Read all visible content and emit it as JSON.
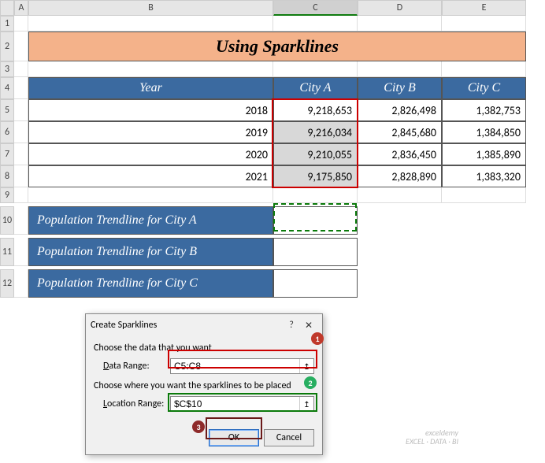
{
  "columns": [
    "A",
    "B",
    "C",
    "D",
    "E"
  ],
  "title": "Using Sparklines",
  "headers": {
    "year": "Year",
    "cityA": "City A",
    "cityB": "City B",
    "cityC": "City C"
  },
  "rows": [
    {
      "year": "2018",
      "a": "9,218,653",
      "b": "2,826,498",
      "c": "1,382,753"
    },
    {
      "year": "2019",
      "a": "9,216,034",
      "b": "2,845,680",
      "c": "1,384,850"
    },
    {
      "year": "2020",
      "a": "9,210,055",
      "b": "2,836,450",
      "c": "1,385,890"
    },
    {
      "year": "2021",
      "a": "9,175,850",
      "b": "2,828,890",
      "c": "1,383,320"
    }
  ],
  "trend_labels": {
    "a": "Population Trendline for City A",
    "b": "Population Trendline for City B",
    "c": "Population Trendline for City C"
  },
  "dialog": {
    "title": "Create Sparklines",
    "section1": "Choose the data that you want",
    "data_range_label": "Data Range:",
    "data_range_value": "C5:C8",
    "section2": "Choose where you want the sparklines to be placed",
    "location_label": "Location Range:",
    "location_value": "$C$10",
    "ok": "OK",
    "cancel": "Cancel",
    "help": "?",
    "close": "✕",
    "ref_icon": "↥"
  },
  "row_nums": [
    "1",
    "2",
    "3",
    "4",
    "5",
    "6",
    "7",
    "8",
    "9",
    "10",
    "11",
    "12"
  ],
  "watermark": {
    "l1": "exceldemy",
    "l2": "EXCEL · DATA · BI"
  },
  "chart_data": {
    "type": "table",
    "title": "Using Sparklines",
    "columns": [
      "Year",
      "City A",
      "City B",
      "City C"
    ],
    "rows": [
      [
        2018,
        9218653,
        2826498,
        1382753
      ],
      [
        2019,
        9216034,
        2845680,
        1384850
      ],
      [
        2020,
        9210055,
        2836450,
        1385890
      ],
      [
        2021,
        9175850,
        2828890,
        1383320
      ]
    ]
  }
}
